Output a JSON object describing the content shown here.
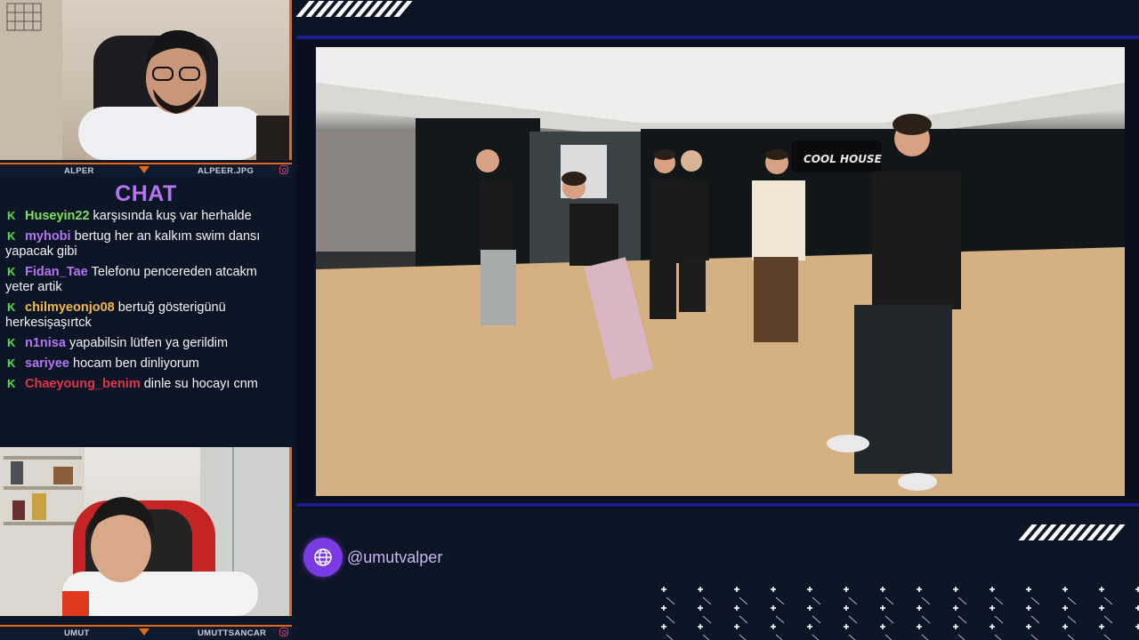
{
  "cams": {
    "top": {
      "left_label": "ALPER",
      "right_label": "ALPEER.JPG"
    },
    "bottom": {
      "left_label": "UMUT",
      "right_label": "UMUTTSANCAR"
    }
  },
  "chat": {
    "title": "CHAT",
    "messages": [
      {
        "user": "Huseyin22",
        "color": "#7be05b",
        "text": "karşısında kuş var herhalde"
      },
      {
        "user": "myhobi",
        "color": "#b574f0",
        "text": "bertug her an kalkım swim dansı yapacak gibi"
      },
      {
        "user": "Fidan_Tae",
        "color": "#b574f0",
        "text": "Telefonu pencereden atcakm yeter artik"
      },
      {
        "user": "chilmyeonjo08",
        "color": "#f2b84b",
        "text": "bertuğ gösterigünü herkesişaşırtck"
      },
      {
        "user": "n1nisa",
        "color": "#b574f0",
        "text": "yapabilsin lütfen ya gerildim"
      },
      {
        "user": "sariyee",
        "color": "#b574f0",
        "text": "hocam ben dinliyorum"
      },
      {
        "user": "Chaeyoung_benim",
        "color": "#e0364b",
        "text": "dinle su hocayı cnm"
      }
    ]
  },
  "video": {
    "sign_text": "COOL HOUSE"
  },
  "social": {
    "handle": "@umutvalper",
    "icon": "globe-icon"
  },
  "colors": {
    "accent_orange": "#e06a18",
    "accent_purple": "#7a3be3",
    "frame_blue": "#1b1a8e"
  }
}
